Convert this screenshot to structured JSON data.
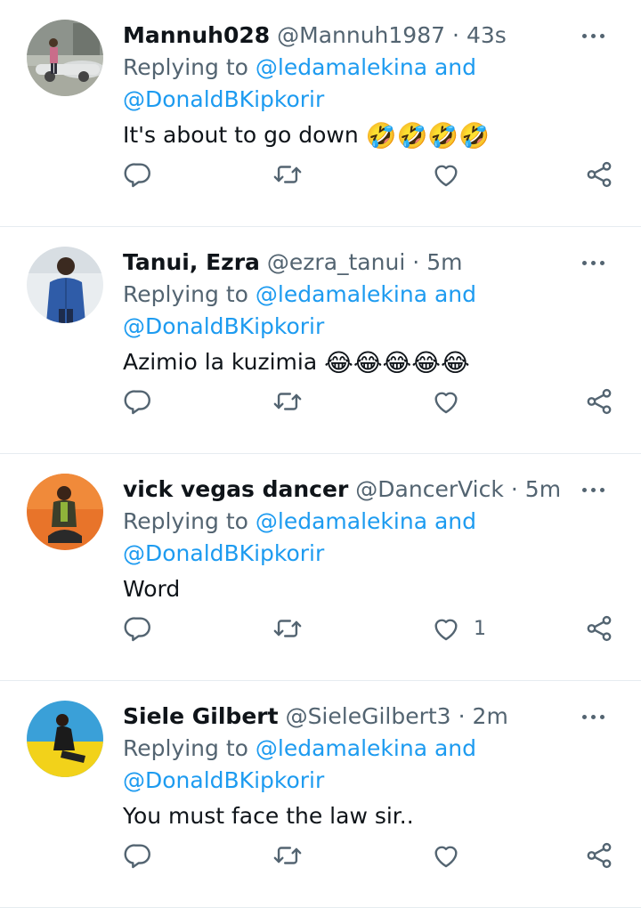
{
  "tweets": [
    {
      "name": "Mannuh028",
      "handle": "@Mannuh1987",
      "dot": "·",
      "time": "43s",
      "replying_prefix": "Replying to",
      "mention1": "@ledamalekina",
      "and": "and",
      "mention2": "@DonaldBKipkorir",
      "text": "It's about to go down",
      "emoji": "🤣🤣🤣🤣",
      "like_count": ""
    },
    {
      "name": "Tanui, Ezra",
      "handle": "@ezra_tanui",
      "dot": "·",
      "time": "5m",
      "replying_prefix": "Replying to",
      "mention1": "@ledamalekina",
      "and": "and",
      "mention2": "@DonaldBKipkorir",
      "text": "Azimio la kuzimia",
      "emoji": "😂😂😂😂😂",
      "like_count": ""
    },
    {
      "name": "vick vegas dancer",
      "handle": "@DancerVick",
      "dot": "·",
      "time": "5m",
      "replying_prefix": "Replying to",
      "mention1": "@ledamalekina",
      "and": "and",
      "mention2": "@DonaldBKipkorir",
      "text": "Word",
      "emoji": "",
      "like_count": "1"
    },
    {
      "name": "Siele Gilbert",
      "handle": "@SieleGilbert3",
      "dot": "·",
      "time": "2m",
      "replying_prefix": "Replying to",
      "mention1": "@ledamalekina",
      "and": "and",
      "mention2": "@DonaldBKipkorir",
      "text": "You must face the law sir..",
      "emoji": "",
      "like_count": ""
    }
  ],
  "icons": {
    "reply": "reply-icon",
    "retweet": "retweet-icon",
    "like": "heart-icon",
    "share": "share-icon",
    "more": "more-icon"
  },
  "colors": {
    "text": "#0f1419",
    "secondary": "#536471",
    "link": "#1d9bf0",
    "divider": "#e6ecf0"
  }
}
